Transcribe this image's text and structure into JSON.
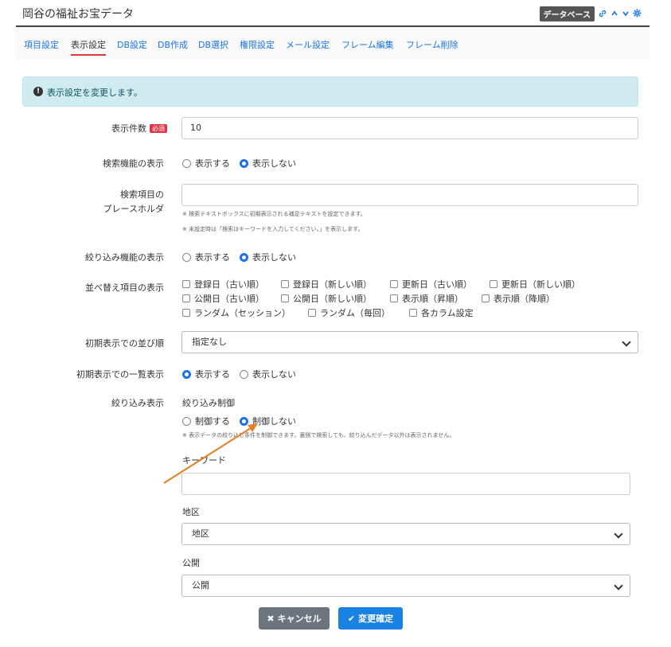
{
  "header": {
    "title": "岡谷の福祉お宝データ",
    "badge": "データベース",
    "icons": [
      "link-icon",
      "chevron-up-icon",
      "chevron-down-icon",
      "gear-icon"
    ]
  },
  "tabs": [
    "項目設定",
    "表示設定",
    "DB設定",
    "DB作成",
    "DB選択",
    "権限設定",
    "メール設定",
    "フレーム編集",
    "フレーム削除"
  ],
  "active_tab": "表示設定",
  "alert": {
    "icon": "info-icon",
    "message": "表示設定を変更します。"
  },
  "form": {
    "display_count": {
      "label": "表示件数",
      "required_badge": "必須",
      "value": "10"
    },
    "search_display": {
      "label": "検索機能の表示",
      "options": [
        "表示する",
        "表示しない"
      ],
      "selected": "表示しない"
    },
    "placeholder": {
      "label_line1": "検索項目の",
      "label_line2": "プレースホルダ",
      "value": "",
      "note1": "※ 検索テキストボックスに初期表示される補足テキストを設定できます。",
      "note2": "※ 未設定時は「検索はキーワードを入力してください。」を表示します。"
    },
    "filter_display": {
      "label": "絞り込み機能の表示",
      "options": [
        "表示する",
        "表示しない"
      ],
      "selected": "表示しない"
    },
    "sort_items": {
      "label": "並べ替え項目の表示",
      "row1": [
        "登録日（古い順）",
        "登録日（新しい順）",
        "更新日（古い順）",
        "更新日（新しい順）"
      ],
      "row2": [
        "公開日（古い順）",
        "公開日（新しい順）",
        "表示順（昇順）",
        "表示順（降順）"
      ],
      "row3": [
        "ランダム（セッション）",
        "ランダム（毎回）",
        "各カラム設定"
      ]
    },
    "initial_sort": {
      "label": "初期表示での並び順",
      "value": "指定なし"
    },
    "initial_list": {
      "label": "初期表示での一覧表示",
      "options": [
        "表示する",
        "表示しない"
      ],
      "selected": "表示する"
    },
    "filter_view": {
      "label": "絞り込み表示",
      "control_label": "絞り込み制御",
      "options": [
        "制御する",
        "制御しない"
      ],
      "selected": "制御しない",
      "note": "※ 表示データの絞り込む条件を制御できます。裏側で検索しても、絞り込んだデータ以外は表示されません。",
      "keyword_label": "キーワード",
      "keyword_value": "",
      "region_label": "地区",
      "region_value": "地区",
      "public_label": "公開",
      "public_value": "公開"
    }
  },
  "buttons": {
    "cancel": "キャンセル",
    "confirm": "変更確定"
  },
  "colors": {
    "accent": "#1a82e2",
    "alert_bg": "#d1ecf1",
    "annotation_arrow": "#e67e22",
    "required": "#dc3545"
  }
}
